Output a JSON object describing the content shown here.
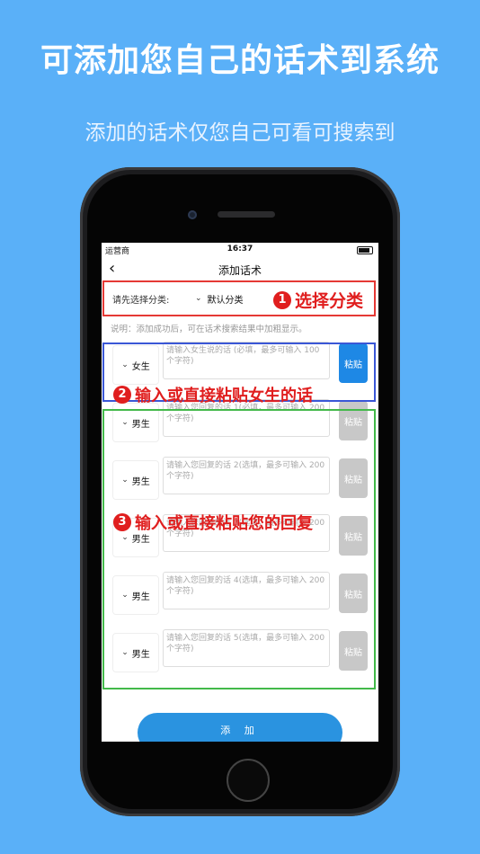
{
  "promo": {
    "headline": "可添加您自己的话术到系统",
    "subline": "添加的话术仅您自己可看可搜索到"
  },
  "statusbar": {
    "carrier": "运营商",
    "time": "16:37"
  },
  "nav": {
    "back_icon": "chevron-left-icon",
    "title": "添加话术"
  },
  "form": {
    "category_label": "请先选择分类:",
    "category_value": "默认分类",
    "note": "说明：添加成功后，可在话术搜索结果中加粗显示。",
    "female_message": {
      "gender": "女生",
      "placeholder": "请输入女生说的话 (必填，最多可输入 100 个字符)",
      "paste_label": "粘贴"
    },
    "replies": [
      {
        "gender": "男生",
        "placeholder": "请输入您回复的话 1(必填，最多可输入 200 个字符)",
        "paste_label": "粘贴"
      },
      {
        "gender": "男生",
        "placeholder": "请输入您回复的话 2(选填，最多可输入 200 个字符)",
        "paste_label": "粘贴"
      },
      {
        "gender": "男生",
        "placeholder": "请输入您回复的话 3(选填，最多可输入 200 个字符)",
        "paste_label": "粘贴"
      },
      {
        "gender": "男生",
        "placeholder": "请输入您回复的话 4(选填，最多可输入 200 个字符)",
        "paste_label": "粘贴"
      },
      {
        "gender": "男生",
        "placeholder": "请输入您回复的话 5(选填，最多可输入 200 个字符)",
        "paste_label": "粘贴"
      }
    ],
    "add_button": "添 加"
  },
  "annotations": {
    "step1": {
      "num": "1",
      "text": "选择分类"
    },
    "step2": {
      "num": "2",
      "text": "输入或直接粘贴女生的话"
    },
    "step3": {
      "num": "3",
      "text": "输入或直接粘贴您的回复"
    }
  },
  "colors": {
    "background": "#5ab0f8",
    "accent": "#2a93e0",
    "annotation_red": "#e01e1e",
    "box_blue": "#3a57d6",
    "box_green": "#43b94a"
  }
}
